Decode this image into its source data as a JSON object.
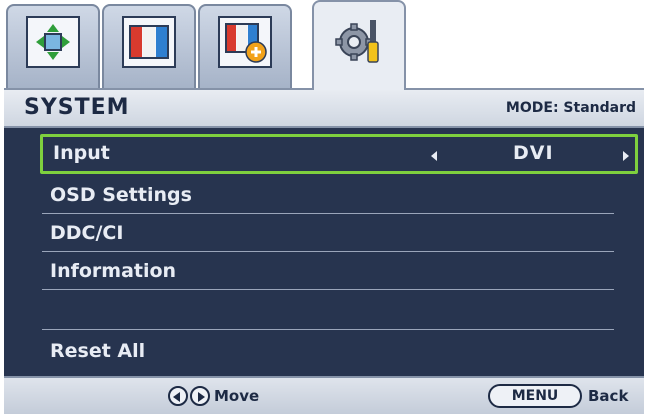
{
  "tabs": [
    {
      "icon": "display-adjust-icon"
    },
    {
      "icon": "color-bars-icon"
    },
    {
      "icon": "picture-advanced-icon"
    },
    {
      "icon": "system-settings-icon",
      "active": true
    }
  ],
  "header": {
    "title": "SYSTEM",
    "mode": "MODE: Standard"
  },
  "menu": {
    "items": [
      {
        "label": "Input",
        "value": "DVI",
        "selected": true
      },
      {
        "label": "OSD Settings"
      },
      {
        "label": "DDC/CI"
      },
      {
        "label": "Information"
      },
      {
        "label": ""
      },
      {
        "label": "Reset All"
      }
    ]
  },
  "footer": {
    "move_label": "Move",
    "menu_button": "MENU",
    "back_label": "Back"
  },
  "colors": {
    "panel": "#27344f",
    "selection_border": "#7ed03e",
    "text": "#e8ecf4"
  }
}
